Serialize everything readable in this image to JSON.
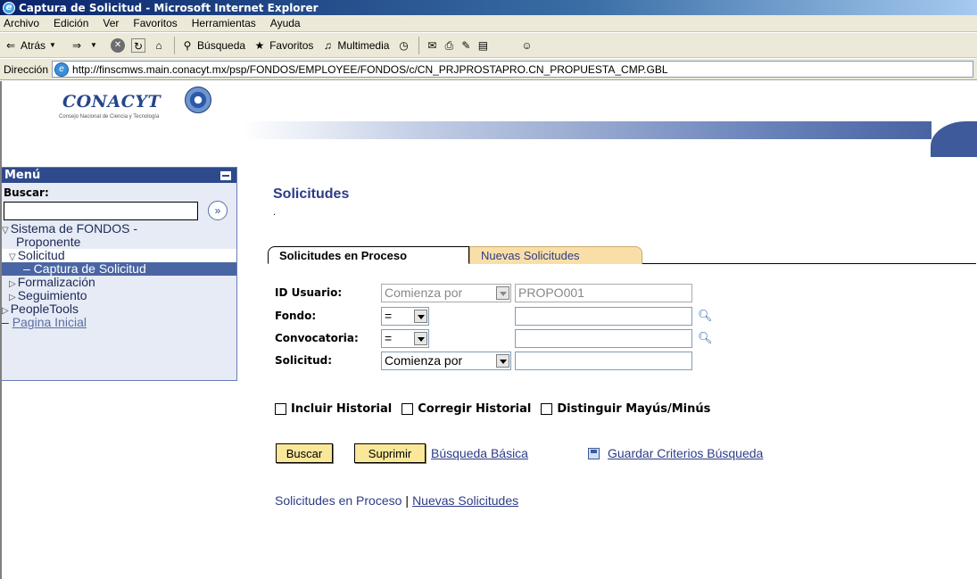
{
  "window": {
    "title": "Captura de Solicitud - Microsoft Internet Explorer"
  },
  "menubar": [
    "Archivo",
    "Edición",
    "Ver",
    "Favoritos",
    "Herramientas",
    "Ayuda"
  ],
  "toolbar": {
    "back": "Atrás",
    "search": "Búsqueda",
    "favorites": "Favoritos",
    "media": "Multimedia"
  },
  "address": {
    "label": "Dirección",
    "url": "http://finscmws.main.conacyt.mx/psp/FONDOS/EMPLOYEE/FONDOS/c/CN_PRJPROSTAPRO.CN_PROPUESTA_CMP.GBL"
  },
  "logo": {
    "name": "CONACYT",
    "subtitle": "Consejo Nacional de Ciencia y Tecnología"
  },
  "nav": {
    "header": "Menú",
    "search_label": "Buscar:",
    "items": [
      {
        "label": "Sistema de FONDOS -",
        "indent": 0,
        "expanded": true
      },
      {
        "label": "Proponente",
        "indent": 1
      },
      {
        "label": "Solicitud",
        "indent": 1,
        "expanded": true
      },
      {
        "label": "– Captura de Solicitud",
        "indent": 2
      },
      {
        "label": "Formalización",
        "indent": 1
      },
      {
        "label": "Seguimiento",
        "indent": 1
      },
      {
        "label": "PeopleTools",
        "indent": 0
      },
      {
        "label": "Pagina Inicial",
        "indent": 0
      }
    ]
  },
  "main": {
    "title": "Solicitudes",
    "dot": ".",
    "tabs": [
      "Solicitudes en Proceso",
      "Nuevas Solicitudes"
    ],
    "fields": {
      "usuario": {
        "label": "ID Usuario:",
        "operator": "Comienza por",
        "value": "PROPO001"
      },
      "fondo": {
        "label": "Fondo:",
        "operator": "=",
        "value": ""
      },
      "convocatoria": {
        "label": "Convocatoria:",
        "operator": "=",
        "value": ""
      },
      "solicitud": {
        "label": "Solicitud:",
        "operator": "Comienza por",
        "value": ""
      }
    },
    "checkboxes": [
      "Incluir Historial",
      "Corregir Historial",
      "Distinguir Mayús/Minús"
    ],
    "buttons": {
      "search": "Buscar",
      "clear": "Suprimir"
    },
    "links": {
      "basic": "Búsqueda Básica",
      "save": "Guardar Criterios Búsqueda"
    },
    "bottom_links": [
      "Solicitudes en Proceso",
      "Nuevas Solicitudes"
    ]
  }
}
